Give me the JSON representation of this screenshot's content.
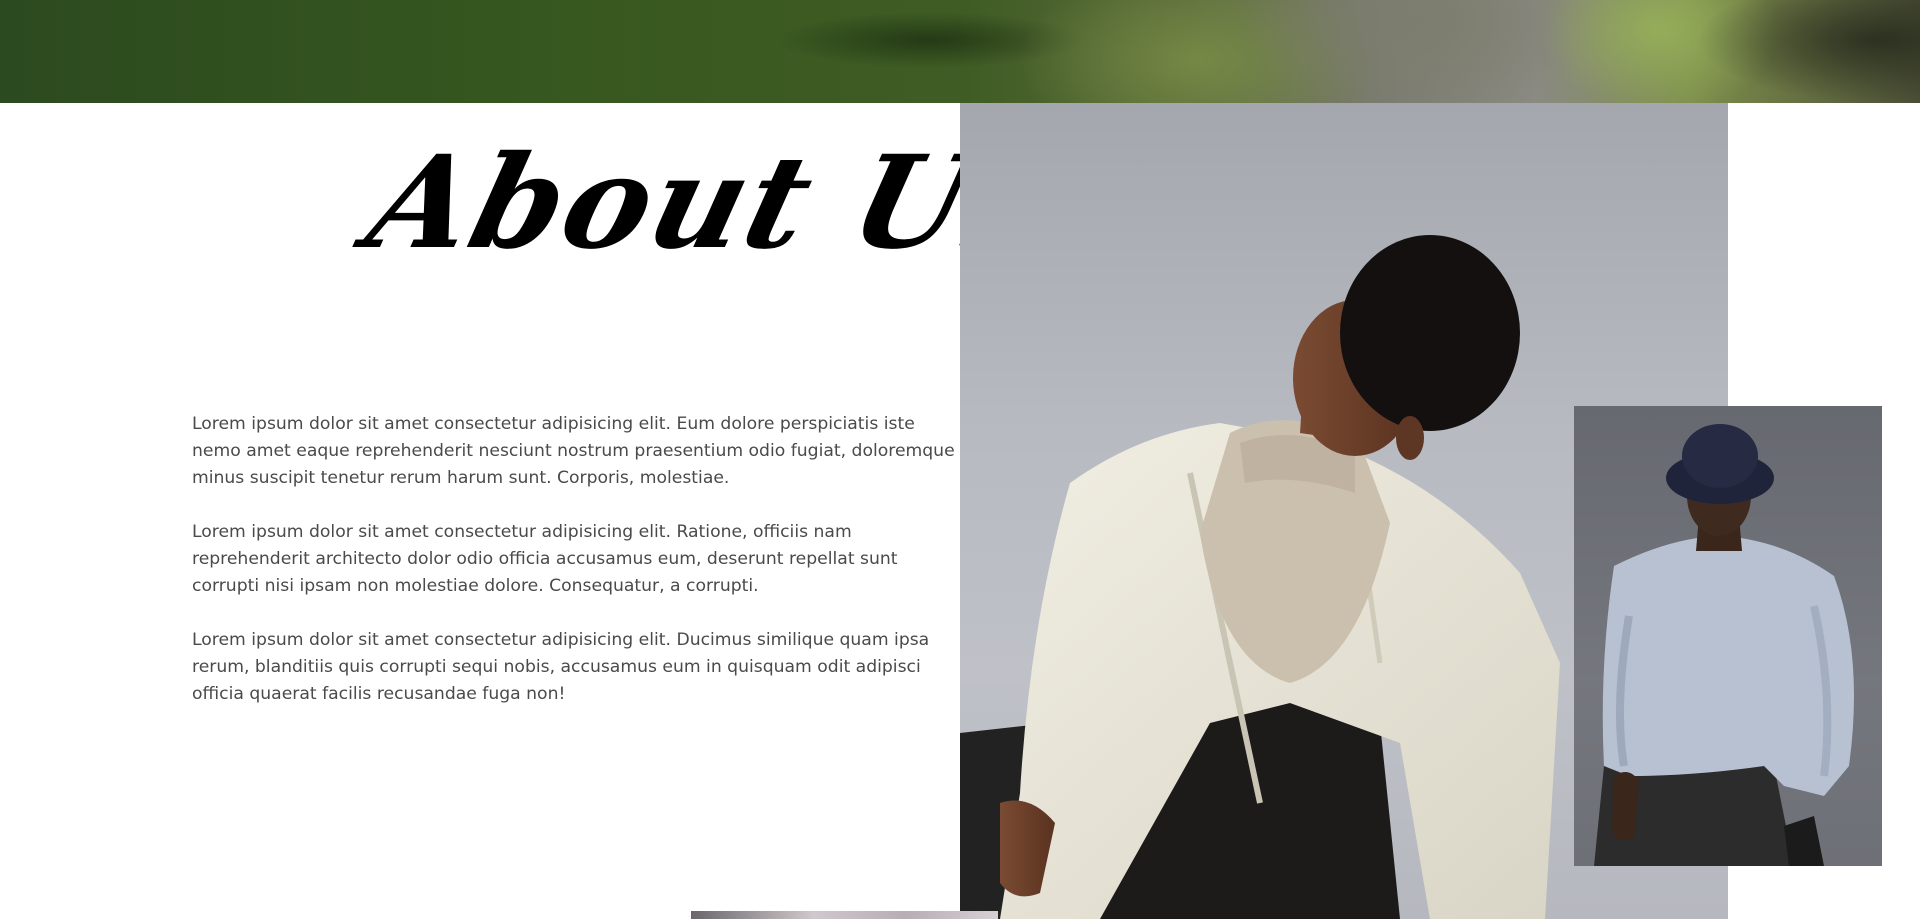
{
  "about": {
    "title": "About Us",
    "paragraphs": [
      "Lorem ipsum dolor sit amet consectetur adipisicing elit. Eum dolore perspiciatis iste nemo amet eaque reprehenderit nesciunt nostrum praesentium odio fugiat, doloremque minus suscipit tenetur rerum harum sunt. Corporis, molestiae.",
      "Lorem ipsum dolor sit amet consectetur adipisicing elit. Ratione, officiis nam reprehenderit architecto dolor odio officia accusamus eum, deserunt repellat sunt corrupti nisi ipsam non molestiae dolore. Consequatur, a corrupti.",
      "Lorem ipsum dolor sit amet consectetur adipisicing elit. Ducimus similique quam ipsa rerum, blanditiis quis corrupti sequi nobis, accusamus eum in quisquam odit adipisci officia quaerat facilis recusandae fuga non!"
    ]
  },
  "colors": {
    "background": "#ffffff",
    "title": "#000000",
    "body_text": "#4a4a4a"
  },
  "images": {
    "hero": "blurred-green-leaf-photo",
    "main": "man-in-cream-corduroy-jacket-looking-up",
    "side": "man-in-bucket-hat-and-light-blue-sweatshirt",
    "bottom": "partial-gallery-thumbnail"
  }
}
